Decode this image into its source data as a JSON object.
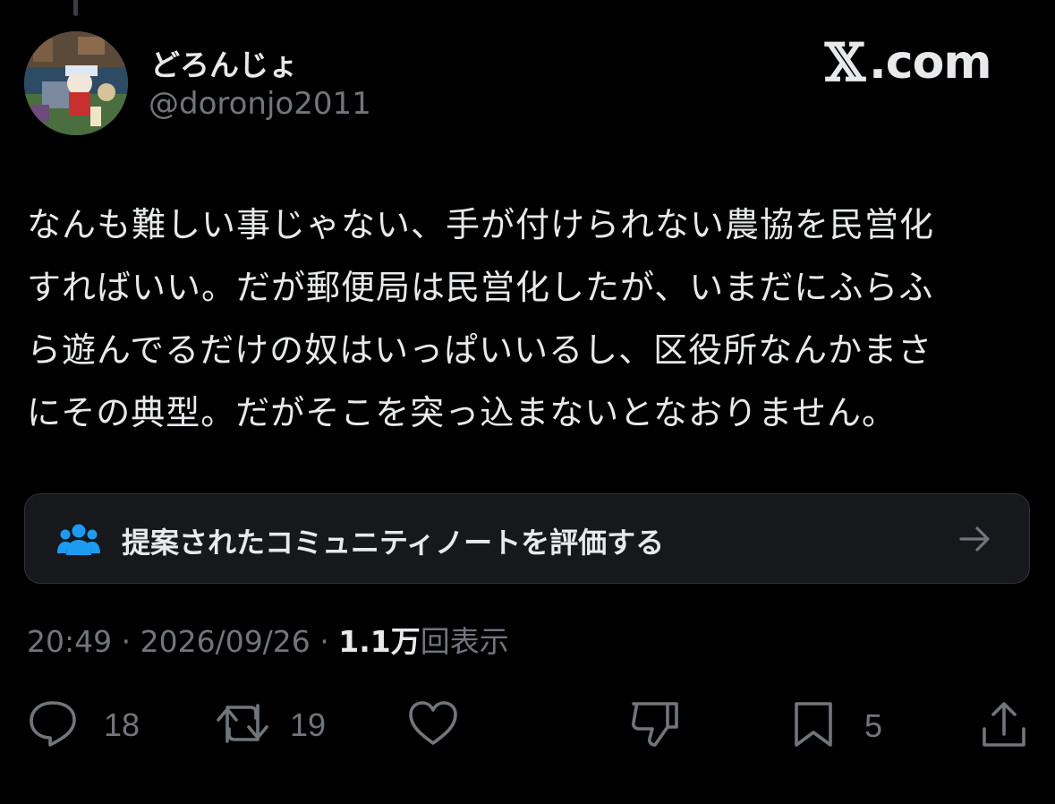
{
  "author": {
    "display_name": "どろんじょ",
    "handle": "@doronjo2011",
    "avatar_icon": "avatar-game-character-image"
  },
  "brand": {
    "logo_letter": "𝕏",
    "logo_suffix": ".com"
  },
  "tweet": {
    "lines": [
      "なんも難しい事じゃない、手が付けられない農協を民営化",
      "すればいい。だが郵便局は民営化したが、いまだにふらふ",
      "ら遊んでるだけの奴はいっぱいいるし、区役所なんかまさ",
      "にその典型。だがそこを突っ込まないとなおりません。"
    ]
  },
  "community_note": {
    "icon": "people-group-icon",
    "label": "提案されたコミュニティノートを評価する",
    "arrow_icon": "arrow-right-icon"
  },
  "meta": {
    "time": "20:49",
    "separator": " · ",
    "date": "2026/09/26",
    "views_count": "1.1万",
    "views_label": "回表示"
  },
  "actions": {
    "reply": {
      "icon": "reply-bubble-icon",
      "count": "18"
    },
    "retweet": {
      "icon": "retweet-icon",
      "count": "19"
    },
    "like": {
      "icon": "heart-icon",
      "count": ""
    },
    "dislike": {
      "icon": "thumbs-down-icon",
      "count": ""
    },
    "bookmark": {
      "icon": "bookmark-icon",
      "count": "5"
    },
    "share": {
      "icon": "share-upload-icon",
      "count": ""
    }
  },
  "colors": {
    "background": "#000000",
    "primary_text": "#e7e9ea",
    "secondary_text": "#71767b",
    "note_icon": "#1d9bf0",
    "card_background": "#16181c",
    "card_border": "#2f3336"
  }
}
